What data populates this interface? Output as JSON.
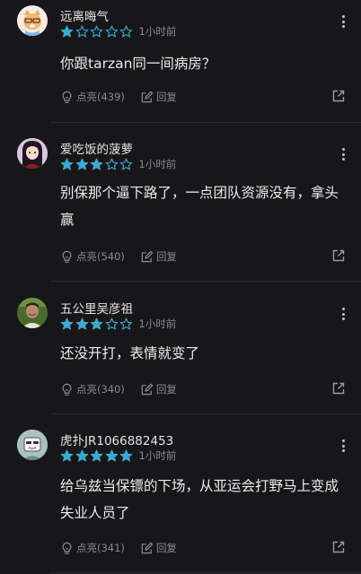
{
  "colors": {
    "star_filled": "#3fa8cf",
    "star_empty_stroke": "#3fa8cf",
    "background": "#17171a"
  },
  "comments": [
    {
      "username": "远离晦气",
      "rating": 1,
      "time": "1小时前",
      "lines": [
        "你跟tarzan同一间病房？"
      ],
      "like_label": "点亮(439)",
      "reply_label": "回复",
      "avatar_icon": "cat-avatar-icon"
    },
    {
      "username": "爱吃饭的菠萝",
      "rating": 3,
      "time": "1小时前",
      "lines": [
        "别保那个逼下路了，一点团队资源没有，拿头",
        "赢"
      ],
      "like_label": "点亮(540)",
      "reply_label": "回复",
      "avatar_icon": "anime-girl-avatar-icon"
    },
    {
      "username": "五公里吴彦祖",
      "rating": 3,
      "time": "1小时前",
      "lines": [
        "还没开打，表情就变了"
      ],
      "like_label": "点亮(340)",
      "reply_label": "回复",
      "avatar_icon": "man-photo-avatar-icon"
    },
    {
      "username": "虎扑JR1066882453",
      "rating": 5,
      "time": "1小时前",
      "lines": [
        "给乌兹当保镖的下场，从亚运会打野马上变成",
        "失业人员了"
      ],
      "like_label": "点亮(341)",
      "reply_label": "回复",
      "avatar_icon": "default-avatar-icon"
    }
  ]
}
